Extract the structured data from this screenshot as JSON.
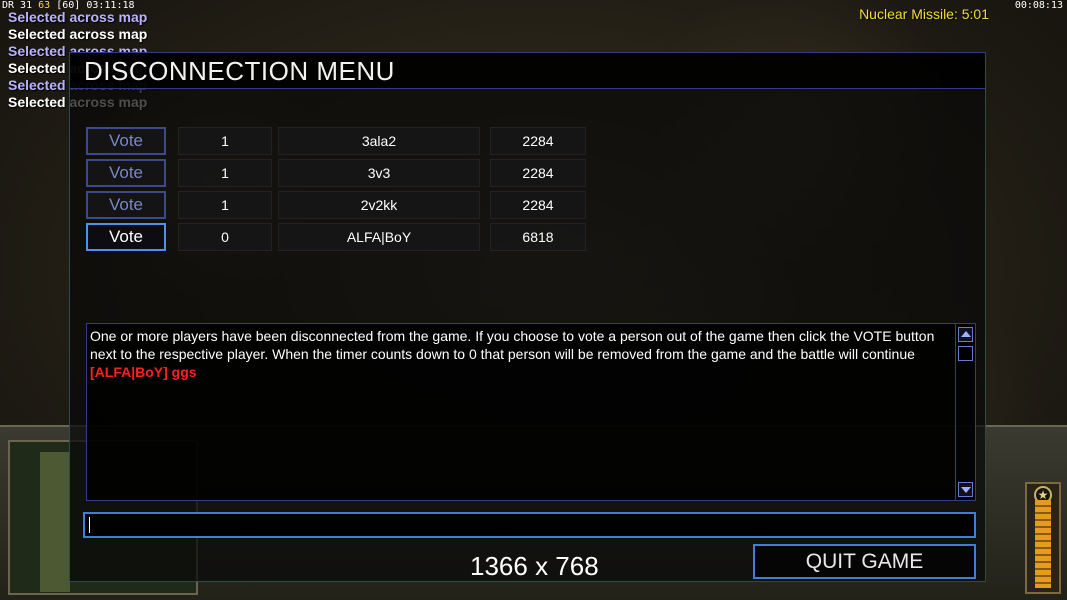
{
  "overlay": {
    "stats_prefix": "DR 31",
    "stats_value": "63",
    "stats_mid": "[60]",
    "stats_time": "03:11:18",
    "game_clock": "00:08:13",
    "superweapon_timer": "Nuclear Missile: 5:01",
    "feed": [
      "Selected across map",
      "Selected across map",
      "Selected across map",
      "Selected across map",
      "Selected across map",
      "Selected across map"
    ]
  },
  "dialog": {
    "title": "DISCONNECTION MENU",
    "vote_label": "Vote",
    "players": [
      {
        "votes": "1",
        "name": "3ala2",
        "ping": "2284",
        "active": false
      },
      {
        "votes": "1",
        "name": "3v3",
        "ping": "2284",
        "active": false
      },
      {
        "votes": "1",
        "name": "2v2kk",
        "ping": "2284",
        "active": false
      },
      {
        "votes": "0",
        "name": "ALFA|BoY",
        "ping": "6818",
        "active": true
      }
    ],
    "chat": {
      "system_message": "One or more players have been disconnected from the game. If you choose to vote a person out of the game then click the VOTE button next to the respective player. When the timer counts down to 0 that person will be removed from the game and the battle will continue",
      "player_message": "[ALFA|BoY] ggs"
    },
    "chat_input_value": "",
    "resolution": "1366 x 768",
    "quit_label": "QUIT GAME"
  },
  "colors": {
    "accent_border": "#3f7fd8",
    "chat_player_message": "#ff2020",
    "superweapon_timer": "#f1dd3a"
  }
}
